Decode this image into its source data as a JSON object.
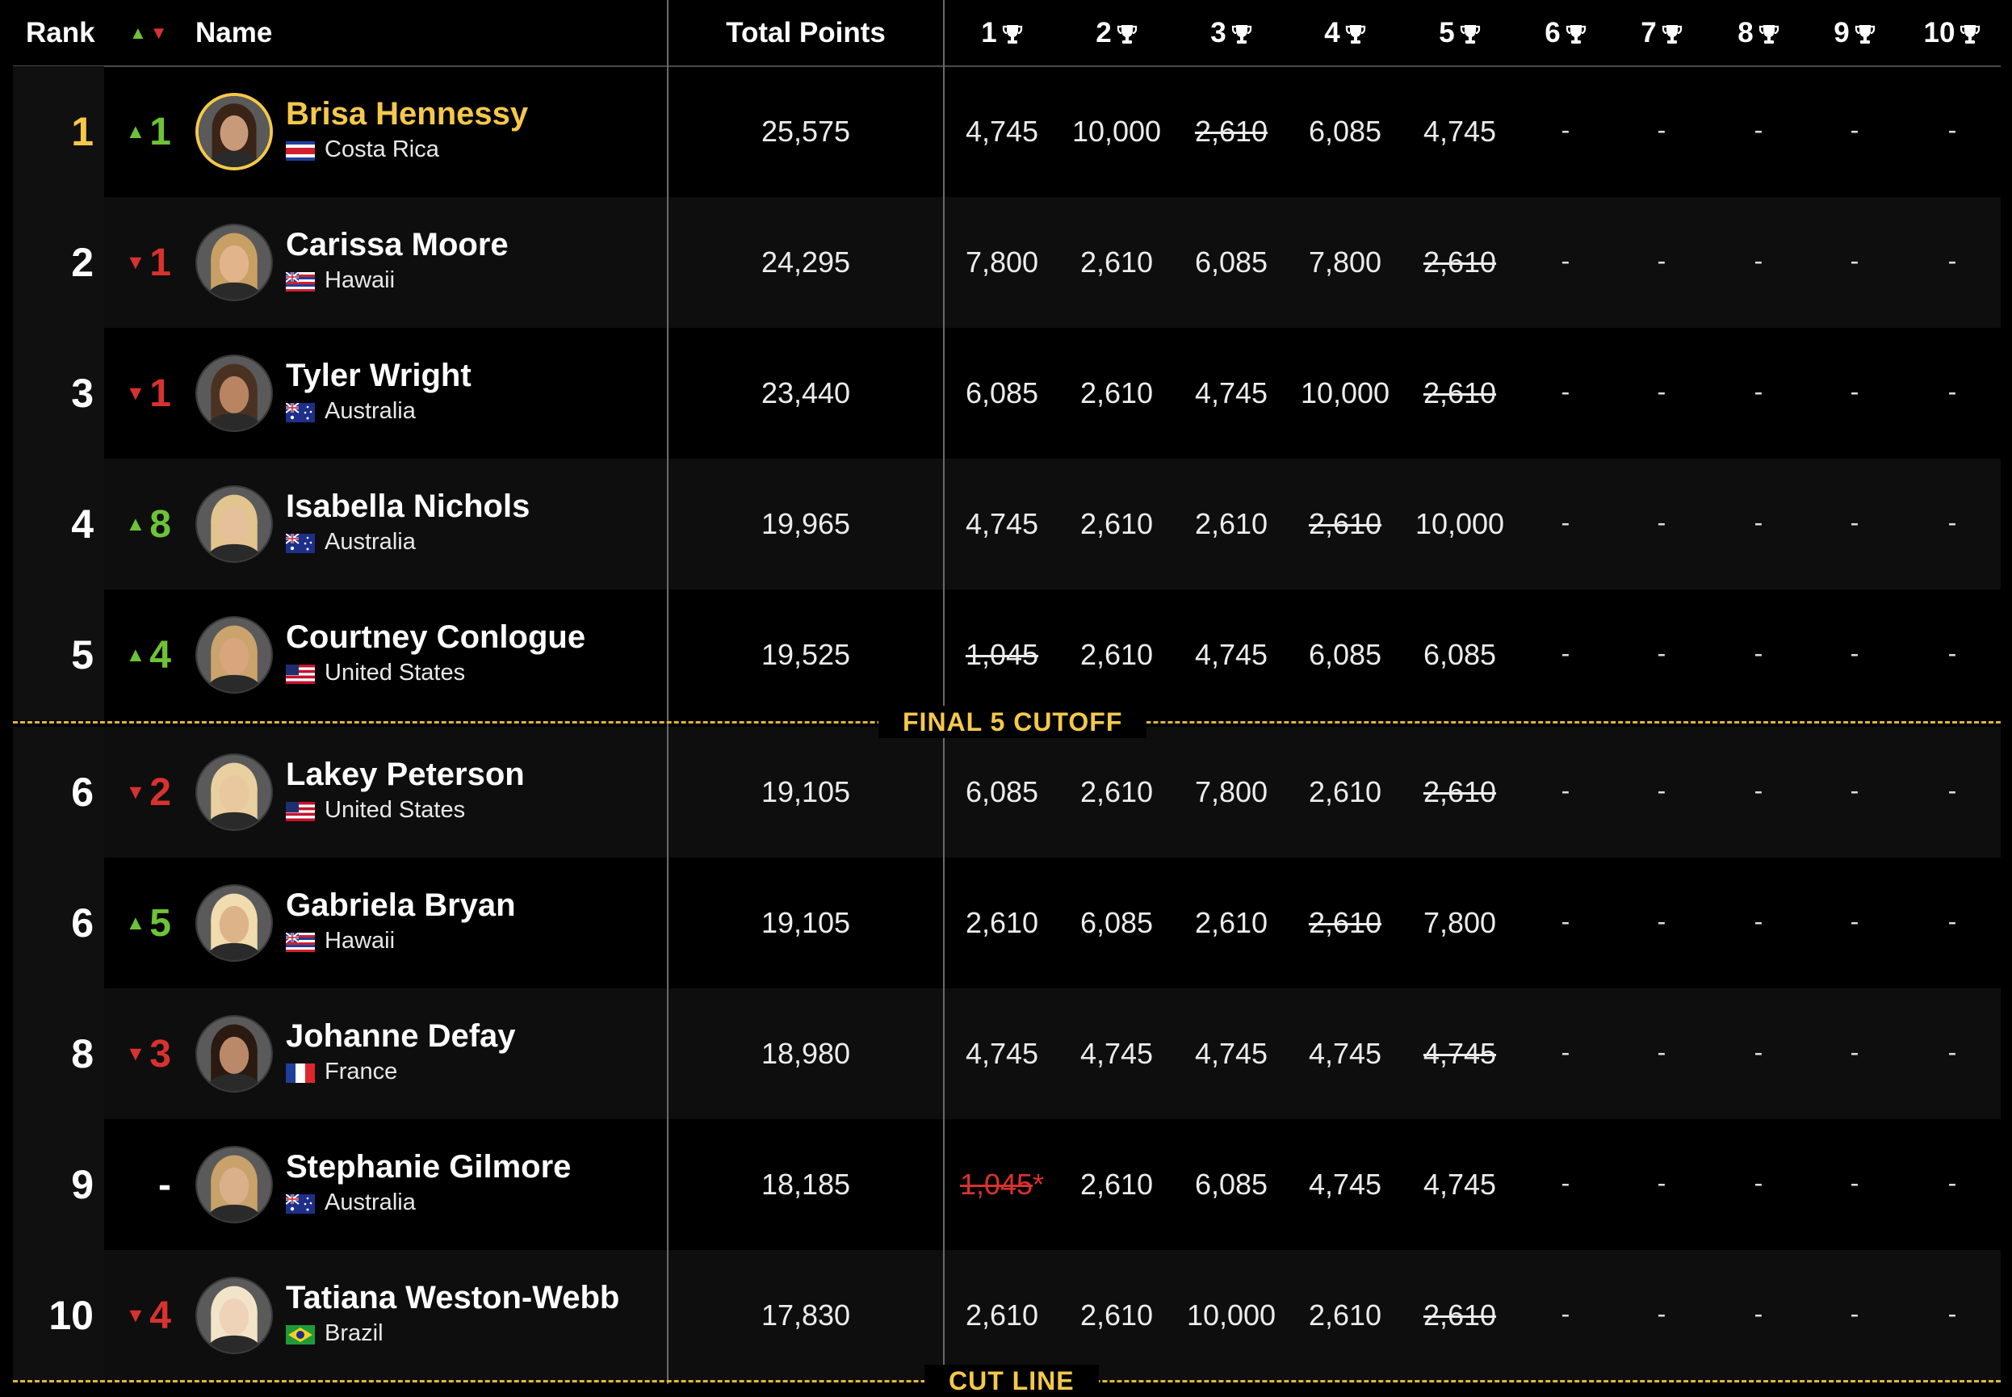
{
  "colors": {
    "gold": "#f4c84a",
    "up": "#6ec238",
    "down": "#d8322f",
    "cut": "#e0b737"
  },
  "header": {
    "rank": "Rank",
    "name": "Name",
    "total": "Total Points",
    "events": [
      "1",
      "2",
      "3",
      "4",
      "5",
      "6",
      "7",
      "8",
      "9",
      "10"
    ]
  },
  "cut_labels": {
    "final5": "FINAL 5 CUTOFF",
    "cutline": "CUT LINE"
  },
  "rows": [
    {
      "rank": "1",
      "dir": "up",
      "move": "1",
      "name": "Brisa Hennessy",
      "country": "Costa Rica",
      "flag": "costa-rica-flag",
      "total": "25,575",
      "scores": [
        {
          "v": "4,745"
        },
        {
          "v": "10,000"
        },
        {
          "v": "2,610",
          "drop": true
        },
        {
          "v": "6,085"
        },
        {
          "v": "4,745"
        }
      ],
      "rest": [
        "-",
        "-",
        "-",
        "-",
        "-"
      ]
    },
    {
      "rank": "2",
      "dir": "down",
      "move": "1",
      "name": "Carissa Moore",
      "country": "Hawaii",
      "flag": "hawaii-flag",
      "total": "24,295",
      "scores": [
        {
          "v": "7,800"
        },
        {
          "v": "2,610"
        },
        {
          "v": "6,085"
        },
        {
          "v": "7,800"
        },
        {
          "v": "2,610",
          "drop": true
        }
      ],
      "rest": [
        "-",
        "-",
        "-",
        "-",
        "-"
      ]
    },
    {
      "rank": "3",
      "dir": "down",
      "move": "1",
      "name": "Tyler Wright",
      "country": "Australia",
      "flag": "australia-flag",
      "total": "23,440",
      "scores": [
        {
          "v": "6,085"
        },
        {
          "v": "2,610"
        },
        {
          "v": "4,745"
        },
        {
          "v": "10,000"
        },
        {
          "v": "2,610",
          "drop": true
        }
      ],
      "rest": [
        "-",
        "-",
        "-",
        "-",
        "-"
      ]
    },
    {
      "rank": "4",
      "dir": "up",
      "move": "8",
      "name": "Isabella Nichols",
      "country": "Australia",
      "flag": "australia-flag",
      "total": "19,965",
      "scores": [
        {
          "v": "4,745"
        },
        {
          "v": "2,610"
        },
        {
          "v": "2,610"
        },
        {
          "v": "2,610",
          "drop": true
        },
        {
          "v": "10,000"
        }
      ],
      "rest": [
        "-",
        "-",
        "-",
        "-",
        "-"
      ]
    },
    {
      "rank": "5",
      "dir": "up",
      "move": "4",
      "name": "Courtney Conlogue",
      "country": "United States",
      "flag": "usa-flag",
      "total": "19,525",
      "scores": [
        {
          "v": "1,045",
          "drop": true
        },
        {
          "v": "2,610"
        },
        {
          "v": "4,745"
        },
        {
          "v": "6,085"
        },
        {
          "v": "6,085"
        }
      ],
      "rest": [
        "-",
        "-",
        "-",
        "-",
        "-"
      ]
    },
    {
      "rank": "6",
      "dir": "down",
      "move": "2",
      "name": "Lakey Peterson",
      "country": "United States",
      "flag": "usa-flag",
      "total": "19,105",
      "scores": [
        {
          "v": "6,085"
        },
        {
          "v": "2,610"
        },
        {
          "v": "7,800"
        },
        {
          "v": "2,610"
        },
        {
          "v": "2,610",
          "drop": true
        }
      ],
      "rest": [
        "-",
        "-",
        "-",
        "-",
        "-"
      ]
    },
    {
      "rank": "6",
      "dir": "up",
      "move": "5",
      "name": "Gabriela Bryan",
      "country": "Hawaii",
      "flag": "hawaii-flag",
      "total": "19,105",
      "scores": [
        {
          "v": "2,610"
        },
        {
          "v": "6,085"
        },
        {
          "v": "2,610"
        },
        {
          "v": "2,610",
          "drop": true
        },
        {
          "v": "7,800"
        }
      ],
      "rest": [
        "-",
        "-",
        "-",
        "-",
        "-"
      ]
    },
    {
      "rank": "8",
      "dir": "down",
      "move": "3",
      "name": "Johanne Defay",
      "country": "France",
      "flag": "france-flag",
      "total": "18,980",
      "scores": [
        {
          "v": "4,745"
        },
        {
          "v": "4,745"
        },
        {
          "v": "4,745"
        },
        {
          "v": "4,745"
        },
        {
          "v": "4,745",
          "drop": true
        }
      ],
      "rest": [
        "-",
        "-",
        "-",
        "-",
        "-"
      ]
    },
    {
      "rank": "9",
      "dir": "none",
      "move": "-",
      "name": "Stephanie Gilmore",
      "country": "Australia",
      "flag": "australia-flag",
      "total": "18,185",
      "scores": [
        {
          "v": "1,045",
          "drop": true,
          "red": true,
          "note": "*"
        },
        {
          "v": "2,610"
        },
        {
          "v": "6,085"
        },
        {
          "v": "4,745"
        },
        {
          "v": "4,745"
        }
      ],
      "rest": [
        "-",
        "-",
        "-",
        "-",
        "-"
      ]
    },
    {
      "rank": "10",
      "dir": "down",
      "move": "4",
      "name": "Tatiana Weston-Webb",
      "country": "Brazil",
      "flag": "brazil-flag",
      "total": "17,830",
      "scores": [
        {
          "v": "2,610"
        },
        {
          "v": "2,610"
        },
        {
          "v": "10,000"
        },
        {
          "v": "2,610"
        },
        {
          "v": "2,610",
          "drop": true
        }
      ],
      "rest": [
        "-",
        "-",
        "-",
        "-",
        "-"
      ]
    }
  ]
}
